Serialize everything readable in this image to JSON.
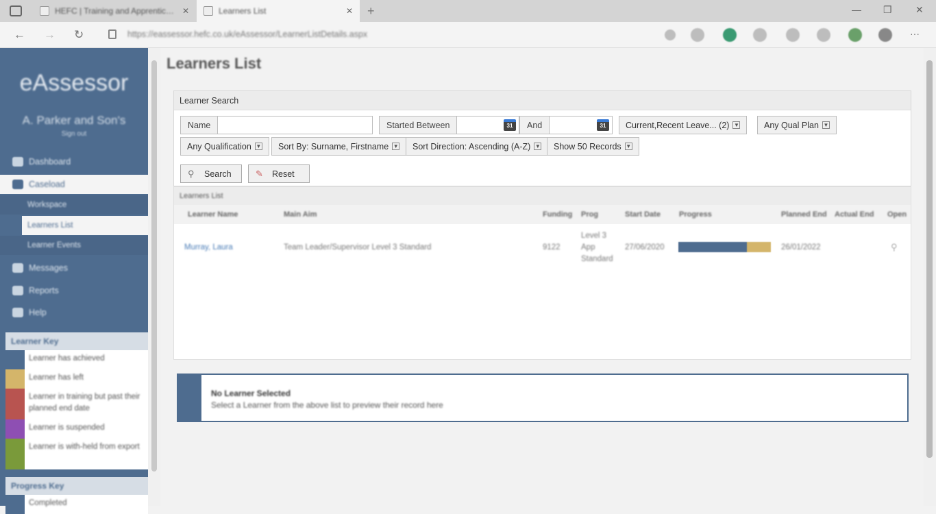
{
  "browser": {
    "tabs": [
      {
        "label": "HEFC | Training and Apprenticeship"
      },
      {
        "label": "Learners List"
      }
    ],
    "url": "https://eassessor.hefc.co.uk/eAssessor/LearnerListDetails.aspx"
  },
  "sidebar": {
    "logo": "eAssessor",
    "company": "A. Parker and Son's",
    "signout": "Sign out",
    "nav": [
      {
        "label": "Dashboard",
        "icon": "dashboard-icon"
      },
      {
        "label": "Caseload",
        "icon": "users-icon"
      },
      {
        "label": "Messages",
        "icon": "envelope-icon"
      },
      {
        "label": "Reports",
        "icon": "chart-icon"
      },
      {
        "label": "Help",
        "icon": "question-icon"
      }
    ],
    "subnav": [
      {
        "label": "Workspace"
      },
      {
        "label": "Learners List"
      },
      {
        "label": "Learner Events"
      }
    ],
    "learner_key_title": "Learner Key",
    "learner_key": [
      {
        "label": "Learner has achieved",
        "color": "#4e6c8f"
      },
      {
        "label": "Learner has left",
        "color": "#d4b56a"
      },
      {
        "label": "Learner in training but past their planned end date",
        "color": "#b85450"
      },
      {
        "label": "Learner is suspended",
        "color": "#8e4fb3"
      },
      {
        "label": "Learner is with-held from export",
        "color": "#7a9a3a"
      }
    ],
    "progress_key_title": "Progress Key",
    "progress_key": [
      {
        "label": "Completed",
        "color": "#4e6c8f"
      }
    ]
  },
  "main": {
    "title": "Learners List",
    "search": {
      "header": "Learner Search",
      "name_label": "Name",
      "name_value": "",
      "started_between_label": "Started Between",
      "and_label": "And",
      "calendar_glyph": "31",
      "status_filter": "Current,Recent Leave... (2)",
      "qual_plan": "Any Qual Plan",
      "qualification": "Any Qualification",
      "sort_by": "Sort By: Surname, Firstname",
      "sort_direction": "Sort Direction: Ascending (A-Z)",
      "show_records": "Show 50 Records",
      "search_btn": "Search",
      "reset_btn": "Reset"
    },
    "list": {
      "header": "Learners List",
      "columns": [
        "Learner Name",
        "Main Aim",
        "Funding",
        "Prog",
        "Start Date",
        "Progress",
        "Planned End",
        "Actual End",
        "Open"
      ],
      "rows": [
        {
          "learner_name": "Murray, Laura",
          "main_aim": "Team Leader/Supervisor Level 3 Standard",
          "funding": "9122",
          "prog": "Level 3 App Standard",
          "start_date": "27/06/2020",
          "progress_completed": 0.74,
          "progress_left": 0.26,
          "planned_end": "26/01/2022",
          "actual_end": ""
        }
      ]
    },
    "preview": {
      "title": "No Learner Selected",
      "subtitle": "Select a Learner from the above list to preview their record here"
    }
  }
}
